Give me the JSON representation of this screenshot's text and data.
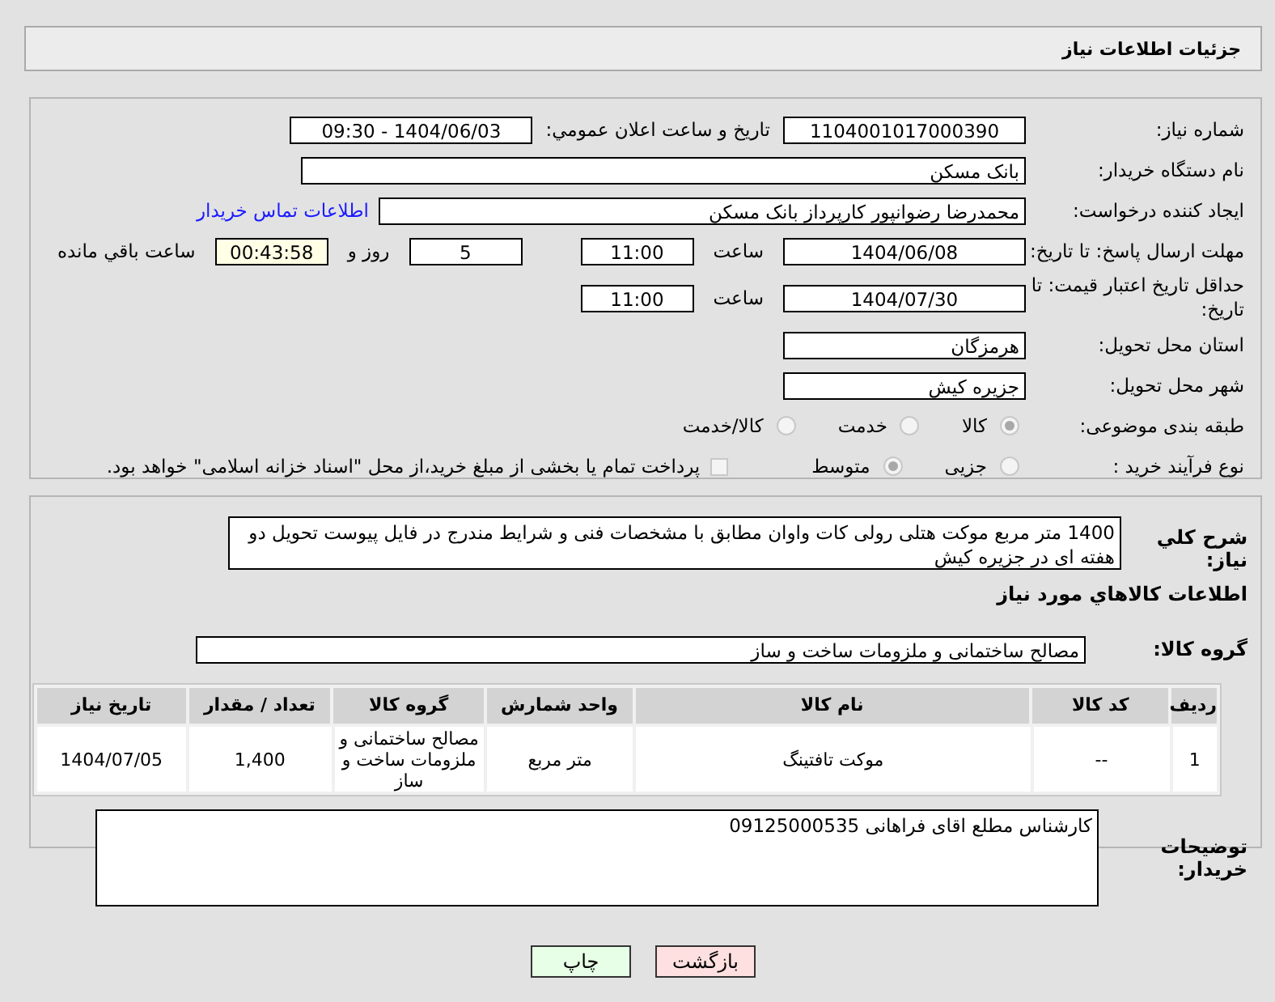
{
  "header": {
    "title": "جزئیات اطلاعات نیاز"
  },
  "form": {
    "need_number": {
      "label": "شماره نیاز:",
      "value": "1104001017000390"
    },
    "announce": {
      "label": "تاریخ و ساعت اعلان عمومي:",
      "value": "1404/06/03 - 09:30"
    },
    "buyer_org": {
      "label": "نام دستگاه خریدار:",
      "value": "بانک مسکن"
    },
    "creator": {
      "label": "ایجاد کننده درخواست:",
      "value": "محمدرضا رضوانپور کارپرداز بانک مسکن",
      "link": "اطلاعات تماس خریدار"
    },
    "deadline": {
      "label": "مهلت ارسال پاسخ: تا تاریخ:",
      "date": "1404/06/08",
      "time_label": "ساعت",
      "time": "11:00",
      "days": "5",
      "days_label": "روز و",
      "remaining": "00:43:58",
      "remaining_label": "ساعت باقي مانده"
    },
    "validity": {
      "label": "حداقل تاریخ اعتبار قیمت: تا تاریخ:",
      "date": "1404/07/30",
      "time_label": "ساعت",
      "time": "11:00"
    },
    "province": {
      "label": "استان محل تحویل:",
      "value": "هرمزگان"
    },
    "city": {
      "label": "شهر محل تحویل:",
      "value": "جزیره کیش"
    },
    "category": {
      "label": "طبقه بندی موضوعی:",
      "options": [
        {
          "label": "کالا",
          "selected": true
        },
        {
          "label": "خدمت",
          "selected": false
        },
        {
          "label": "کالا/خدمت",
          "selected": false
        }
      ]
    },
    "process": {
      "label": "نوع فرآیند خرید :",
      "options": [
        {
          "label": "جزیی",
          "selected": false
        },
        {
          "label": "متوسط",
          "selected": true
        }
      ],
      "payment": {
        "checked": false,
        "text": "پرداخت تمام یا بخشی از مبلغ خرید،از محل \"اسناد خزانه اسلامی\" خواهد بود."
      }
    }
  },
  "details": {
    "description": {
      "label": "شرح كلي نياز:",
      "value": "1400 متر مربع موکت هتلی رولی کات واوان مطابق با مشخصات فنی و شرایط مندرج در فایل پیوست تحویل دو هفته ای در جزیره کیش"
    },
    "section_title": "اطلاعات كالاهاي مورد نياز",
    "group": {
      "label": "گروه کالا:",
      "value": "مصالح ساختمانی و ملزومات ساخت و ساز"
    },
    "table": {
      "columns": [
        "ردیف",
        "کد کالا",
        "نام کالا",
        "واحد شمارش",
        "گروه کالا",
        "تعداد / مقدار",
        "تاریخ نیاز"
      ],
      "rows": [
        [
          "1",
          "--",
          "موکت تافتینگ",
          "متر مربع",
          "مصالح ساختمانی و ملزومات ساخت و ساز",
          "1,400",
          "1404/07/05"
        ]
      ]
    },
    "notes": {
      "label": "توضیحات خریدار:",
      "value": "کارشناس مطلع اقای فراهانی 09125000535"
    }
  },
  "buttons": [
    {
      "label": "بازگشت",
      "kind": "back"
    },
    {
      "label": "چاپ",
      "kind": "print"
    }
  ]
}
